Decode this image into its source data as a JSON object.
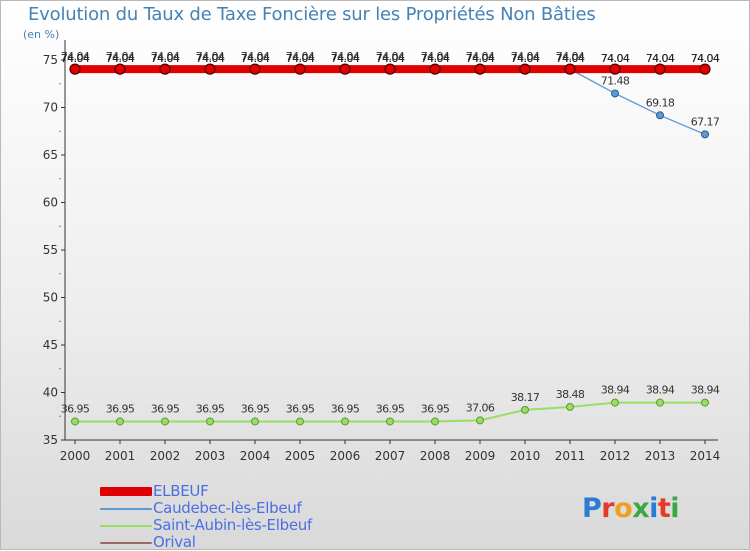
{
  "header": {
    "title": "Evolution du Taux de Taxe Foncière sur les Propriétés Non Bâties",
    "unit": "(en %)"
  },
  "logo": {
    "text": "Proxiti"
  },
  "chart_data": {
    "type": "line",
    "title": "Evolution du Taux de Taxe Foncière sur les Propriétés Non Bâties",
    "ylabel": "(en %)",
    "xlabel": "",
    "x": [
      2000,
      2001,
      2002,
      2003,
      2004,
      2005,
      2006,
      2007,
      2008,
      2009,
      2010,
      2011,
      2012,
      2013,
      2014
    ],
    "ylim": [
      35,
      75
    ],
    "yticks": [
      35,
      40,
      45,
      50,
      55,
      60,
      65,
      70,
      75
    ],
    "grid": false,
    "legend": "bottom-left",
    "series": [
      {
        "name": "ELBEUF",
        "color": "#e00000",
        "values": [
          74.04,
          74.04,
          74.04,
          74.04,
          74.04,
          74.04,
          74.04,
          74.04,
          74.04,
          74.04,
          74.04,
          74.04,
          74.04,
          74.04,
          74.04
        ],
        "labels": [
          "74.04",
          "74.04",
          "74.04",
          "74.04",
          "74.04",
          "74.04",
          "74.04",
          "74.04",
          "74.04",
          "74.04",
          "74.04",
          "74.04",
          "74.04",
          "74.04",
          "74.04"
        ]
      },
      {
        "name": "Caudebec-lès-Elbeuf",
        "color": "#5b9bd5",
        "values": [
          74.04,
          74.04,
          74.04,
          74.04,
          74.04,
          74.04,
          74.04,
          74.04,
          74.04,
          74.04,
          74.04,
          74.04,
          71.48,
          69.18,
          67.17
        ],
        "labels": [
          "74.04",
          "74.04",
          "74.04",
          "74.04",
          "74.04",
          "74.04",
          "74.04",
          "74.04",
          "74.04",
          "74.04",
          "74.04",
          "74.04",
          "71.48",
          "69.18",
          "67.17"
        ]
      },
      {
        "name": "Saint-Aubin-lès-Elbeuf",
        "color": "#99dd66",
        "values": [
          36.95,
          36.95,
          36.95,
          36.95,
          36.95,
          36.95,
          36.95,
          36.95,
          36.95,
          37.06,
          38.17,
          38.48,
          38.94,
          38.94,
          38.94
        ],
        "labels": [
          "36.95",
          "36.95",
          "36.95",
          "36.95",
          "36.95",
          "36.95",
          "36.95",
          "36.95",
          "36.95",
          "37.06",
          "38.17",
          "38.48",
          "38.94",
          "38.94",
          "38.94"
        ]
      },
      {
        "name": "Orival",
        "color": "#9a6a6a",
        "values": [
          74.04,
          74.04,
          74.04,
          74.04,
          74.04,
          74.04,
          74.04,
          74.04,
          74.04,
          74.04,
          74.04,
          74.04,
          74.04,
          74.04,
          74.04
        ],
        "labels": [
          "74.04",
          "74.04",
          "74.04",
          "74.04",
          "74.04",
          "74.04",
          "74.04",
          "74.04",
          "74.04",
          "74.04",
          "74.04",
          "74.04",
          "74.04",
          "74.04",
          "74.04"
        ]
      }
    ]
  }
}
